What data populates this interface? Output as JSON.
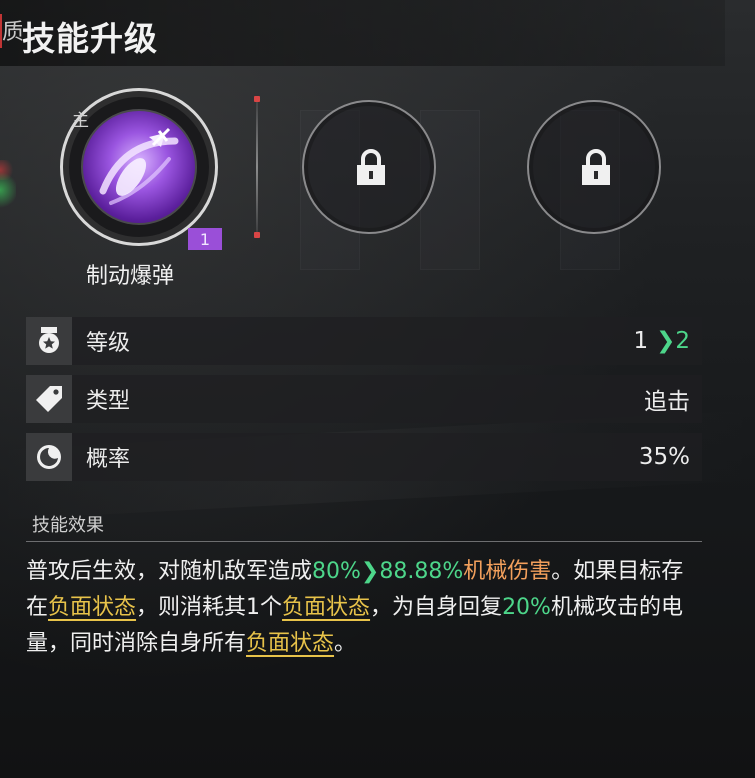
{
  "header": {
    "mark": "质",
    "title": "技能升级"
  },
  "skill": {
    "main_tag": "主",
    "level_badge": "1",
    "name": "制动爆弹",
    "icon": "bomb-skill-icon",
    "locked_slots": 2
  },
  "stats": [
    {
      "icon": "medal-icon",
      "label": "等级",
      "value_from": "1",
      "value_to": "2"
    },
    {
      "icon": "tag-icon",
      "label": "类型",
      "value": "追击"
    },
    {
      "icon": "moon-icon",
      "label": "概率",
      "value": "35%"
    }
  ],
  "effect": {
    "title": "技能效果",
    "segments": [
      {
        "text": "普攻后生效，对随机敌军造成",
        "style": "normal"
      },
      {
        "text": "80%",
        "style": "green"
      },
      {
        "text": "❯",
        "style": "green-arrow"
      },
      {
        "text": "88.88%",
        "style": "green"
      },
      {
        "text": "机械伤害",
        "style": "orange"
      },
      {
        "text": "。如果目标存在",
        "style": "normal"
      },
      {
        "text": "负面状态",
        "style": "gold"
      },
      {
        "text": "，则消耗其1个",
        "style": "normal"
      },
      {
        "text": "负面状态",
        "style": "gold"
      },
      {
        "text": "，为自身回复",
        "style": "normal"
      },
      {
        "text": "20%",
        "style": "green"
      },
      {
        "text": "机械攻击的电量，同时消除自身所有",
        "style": "normal"
      },
      {
        "text": "负面状态",
        "style": "gold"
      },
      {
        "text": "。",
        "style": "normal"
      }
    ]
  },
  "colors": {
    "green": "#4dd68a",
    "orange": "#f3a05c",
    "gold": "#e8c34a",
    "badge_purple": "#9a4fd8"
  }
}
